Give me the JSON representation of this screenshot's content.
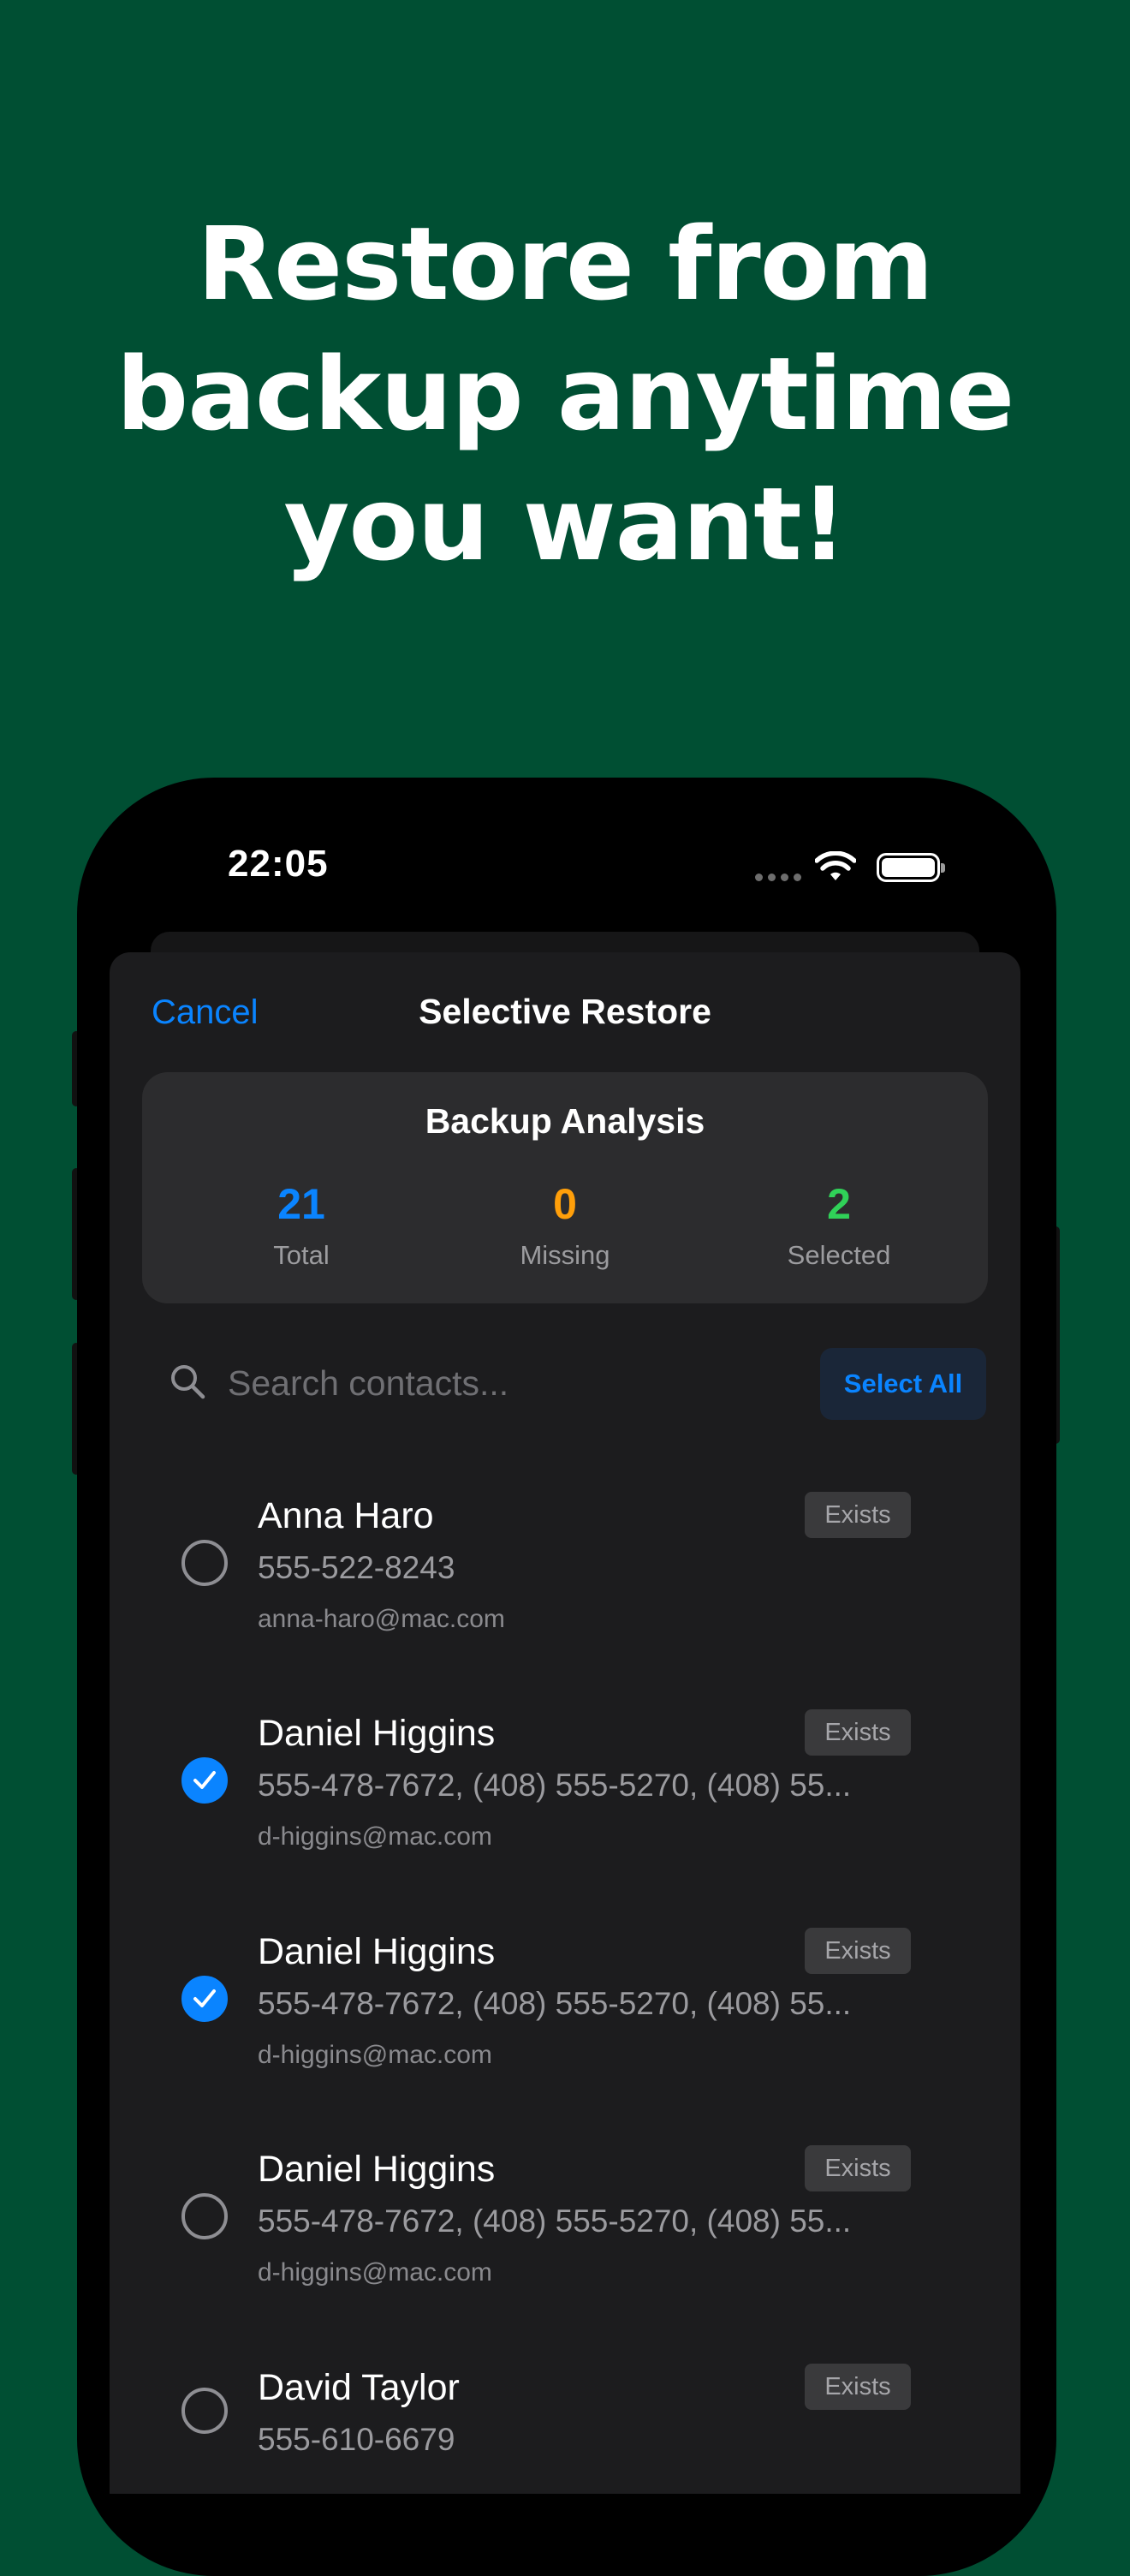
{
  "headline": [
    "Restore from",
    "backup anytime",
    "you want!"
  ],
  "colors": {
    "background": "#004f33",
    "accent": "#0a84ff",
    "missing": "#ff9f0a",
    "selected": "#30d158"
  },
  "status_bar": {
    "time": "22:05",
    "icons": [
      "cellular-dots-icon",
      "wifi-icon",
      "battery-icon"
    ]
  },
  "nav": {
    "cancel": "Cancel",
    "title": "Selective Restore"
  },
  "analysis": {
    "title": "Backup Analysis",
    "stats": [
      {
        "value": "21",
        "label": "Total"
      },
      {
        "value": "0",
        "label": "Missing"
      },
      {
        "value": "2",
        "label": "Selected"
      }
    ]
  },
  "search": {
    "placeholder": "Search contacts...",
    "value": "",
    "select_all": "Select All"
  },
  "contacts": [
    {
      "name": "Anna Haro",
      "phone": "555-522-8243",
      "email": "anna-haro@mac.com",
      "badge": "Exists",
      "selected": false
    },
    {
      "name": "Daniel Higgins",
      "phone": "555-478-7672, (408) 555-5270, (408) 55...",
      "email": "d-higgins@mac.com",
      "badge": "Exists",
      "selected": true
    },
    {
      "name": "Daniel Higgins",
      "phone": "555-478-7672, (408) 555-5270, (408) 55...",
      "email": "d-higgins@mac.com",
      "badge": "Exists",
      "selected": true
    },
    {
      "name": "Daniel Higgins",
      "phone": "555-478-7672, (408) 555-5270, (408) 55...",
      "email": "d-higgins@mac.com",
      "badge": "Exists",
      "selected": false
    },
    {
      "name": "David Taylor",
      "phone": "555-610-6679",
      "email": "",
      "badge": "Exists",
      "selected": false
    }
  ]
}
